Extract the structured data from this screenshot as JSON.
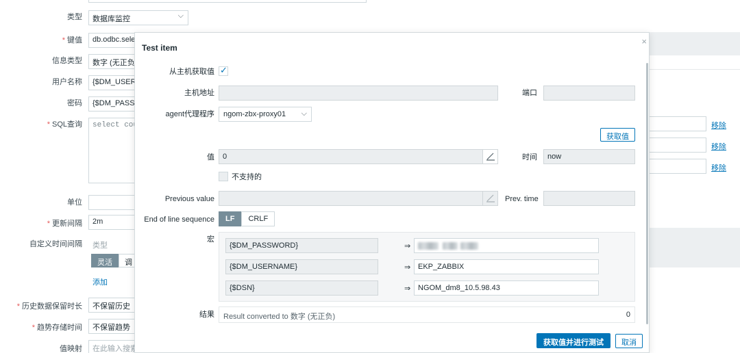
{
  "form": {
    "type": {
      "label": "类型",
      "value": "数据库监控"
    },
    "key": {
      "label": "键值",
      "value": "db.odbc.sele"
    },
    "info_type": {
      "label": "信息类型",
      "value": "数字 (无正负"
    },
    "username": {
      "label": "用户名称",
      "value": "{$DM_USER"
    },
    "password": {
      "label": "密码",
      "value": "{$DM_PASS"
    },
    "sql": {
      "label": "SQL查询",
      "value": "select cou"
    },
    "units": {
      "label": "单位",
      "value": ""
    },
    "update_interval": {
      "label": "更新间隔",
      "value": "2m"
    },
    "custom_intervals": {
      "label": "自定义时间间隔",
      "type_header": "类型",
      "seg_flexible": "灵活",
      "seg_scheduling": "调",
      "add_link": "添加"
    },
    "history": {
      "label": "历史数据保留时长",
      "value": "不保留历史"
    },
    "trends": {
      "label": "趋势存储时间",
      "value": "不保留趋势"
    },
    "value_map": {
      "label": "值映射",
      "placeholder": "在此输入搜索"
    },
    "remove_links": [
      "移除",
      "移除",
      "移除"
    ]
  },
  "modal": {
    "title": "Test item",
    "close": "×",
    "get_from_host_label": "从主机获取值",
    "host_address_label": "主机地址",
    "port_label": "端口",
    "proxy_label": "agent代理程序",
    "proxy_value": "ngom-zbx-proxy01",
    "get_value_button": "获取值",
    "value_label": "值",
    "value_value": "0",
    "time_label": "时间",
    "time_value": "now",
    "not_supported_label": "不支持的",
    "previous_value_label": "Previous value",
    "prev_time_label": "Prev. time",
    "eol_label": "End of line sequence",
    "eol_options": [
      "LF",
      "CRLF"
    ],
    "macros_label": "宏",
    "macros": [
      {
        "name": "{$DM_PASSWORD}",
        "arrow": "⇒",
        "value": ""
      },
      {
        "name": "{$DM_USERNAME}",
        "arrow": "⇒",
        "value": "EKP_ZABBIX"
      },
      {
        "name": "{$DSN}",
        "arrow": "⇒",
        "value": "NGOM_dm8_10.5.98.43"
      }
    ],
    "result_label": "结果",
    "result_text": "Result converted to 数字 (无正负)",
    "result_value": "0",
    "get_and_test_button": "获取值并进行测试",
    "cancel_button": "取消"
  },
  "colors": {
    "accent": "#0275b8",
    "segment_active": "#768d99",
    "readonly_field": "#ebeef0"
  }
}
